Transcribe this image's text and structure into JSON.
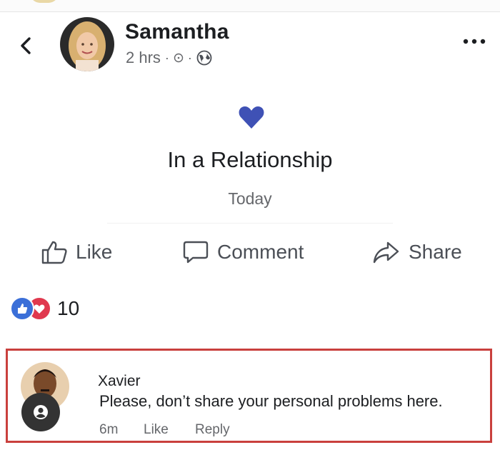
{
  "post": {
    "author": "Samantha",
    "time": "2 hrs",
    "dot_separator": "·"
  },
  "life_event": {
    "title": "In a Relationship",
    "date": "Today",
    "icon": "heart-icon",
    "icon_color": "#3f51b5"
  },
  "actions": {
    "like": "Like",
    "comment": "Comment",
    "share": "Share"
  },
  "reactions": {
    "types": [
      "like-icon",
      "love-icon"
    ],
    "count": "10"
  },
  "comment": {
    "author": "Xavier",
    "text": "Please, don’t share your personal problems here.",
    "time": "6m",
    "like_label": "Like",
    "reply_label": "Reply"
  },
  "colors": {
    "highlight_border": "#c9403d",
    "like_blue": "#3b6fd8",
    "love_red": "#e0384e",
    "secondary_text": "#65676b"
  }
}
